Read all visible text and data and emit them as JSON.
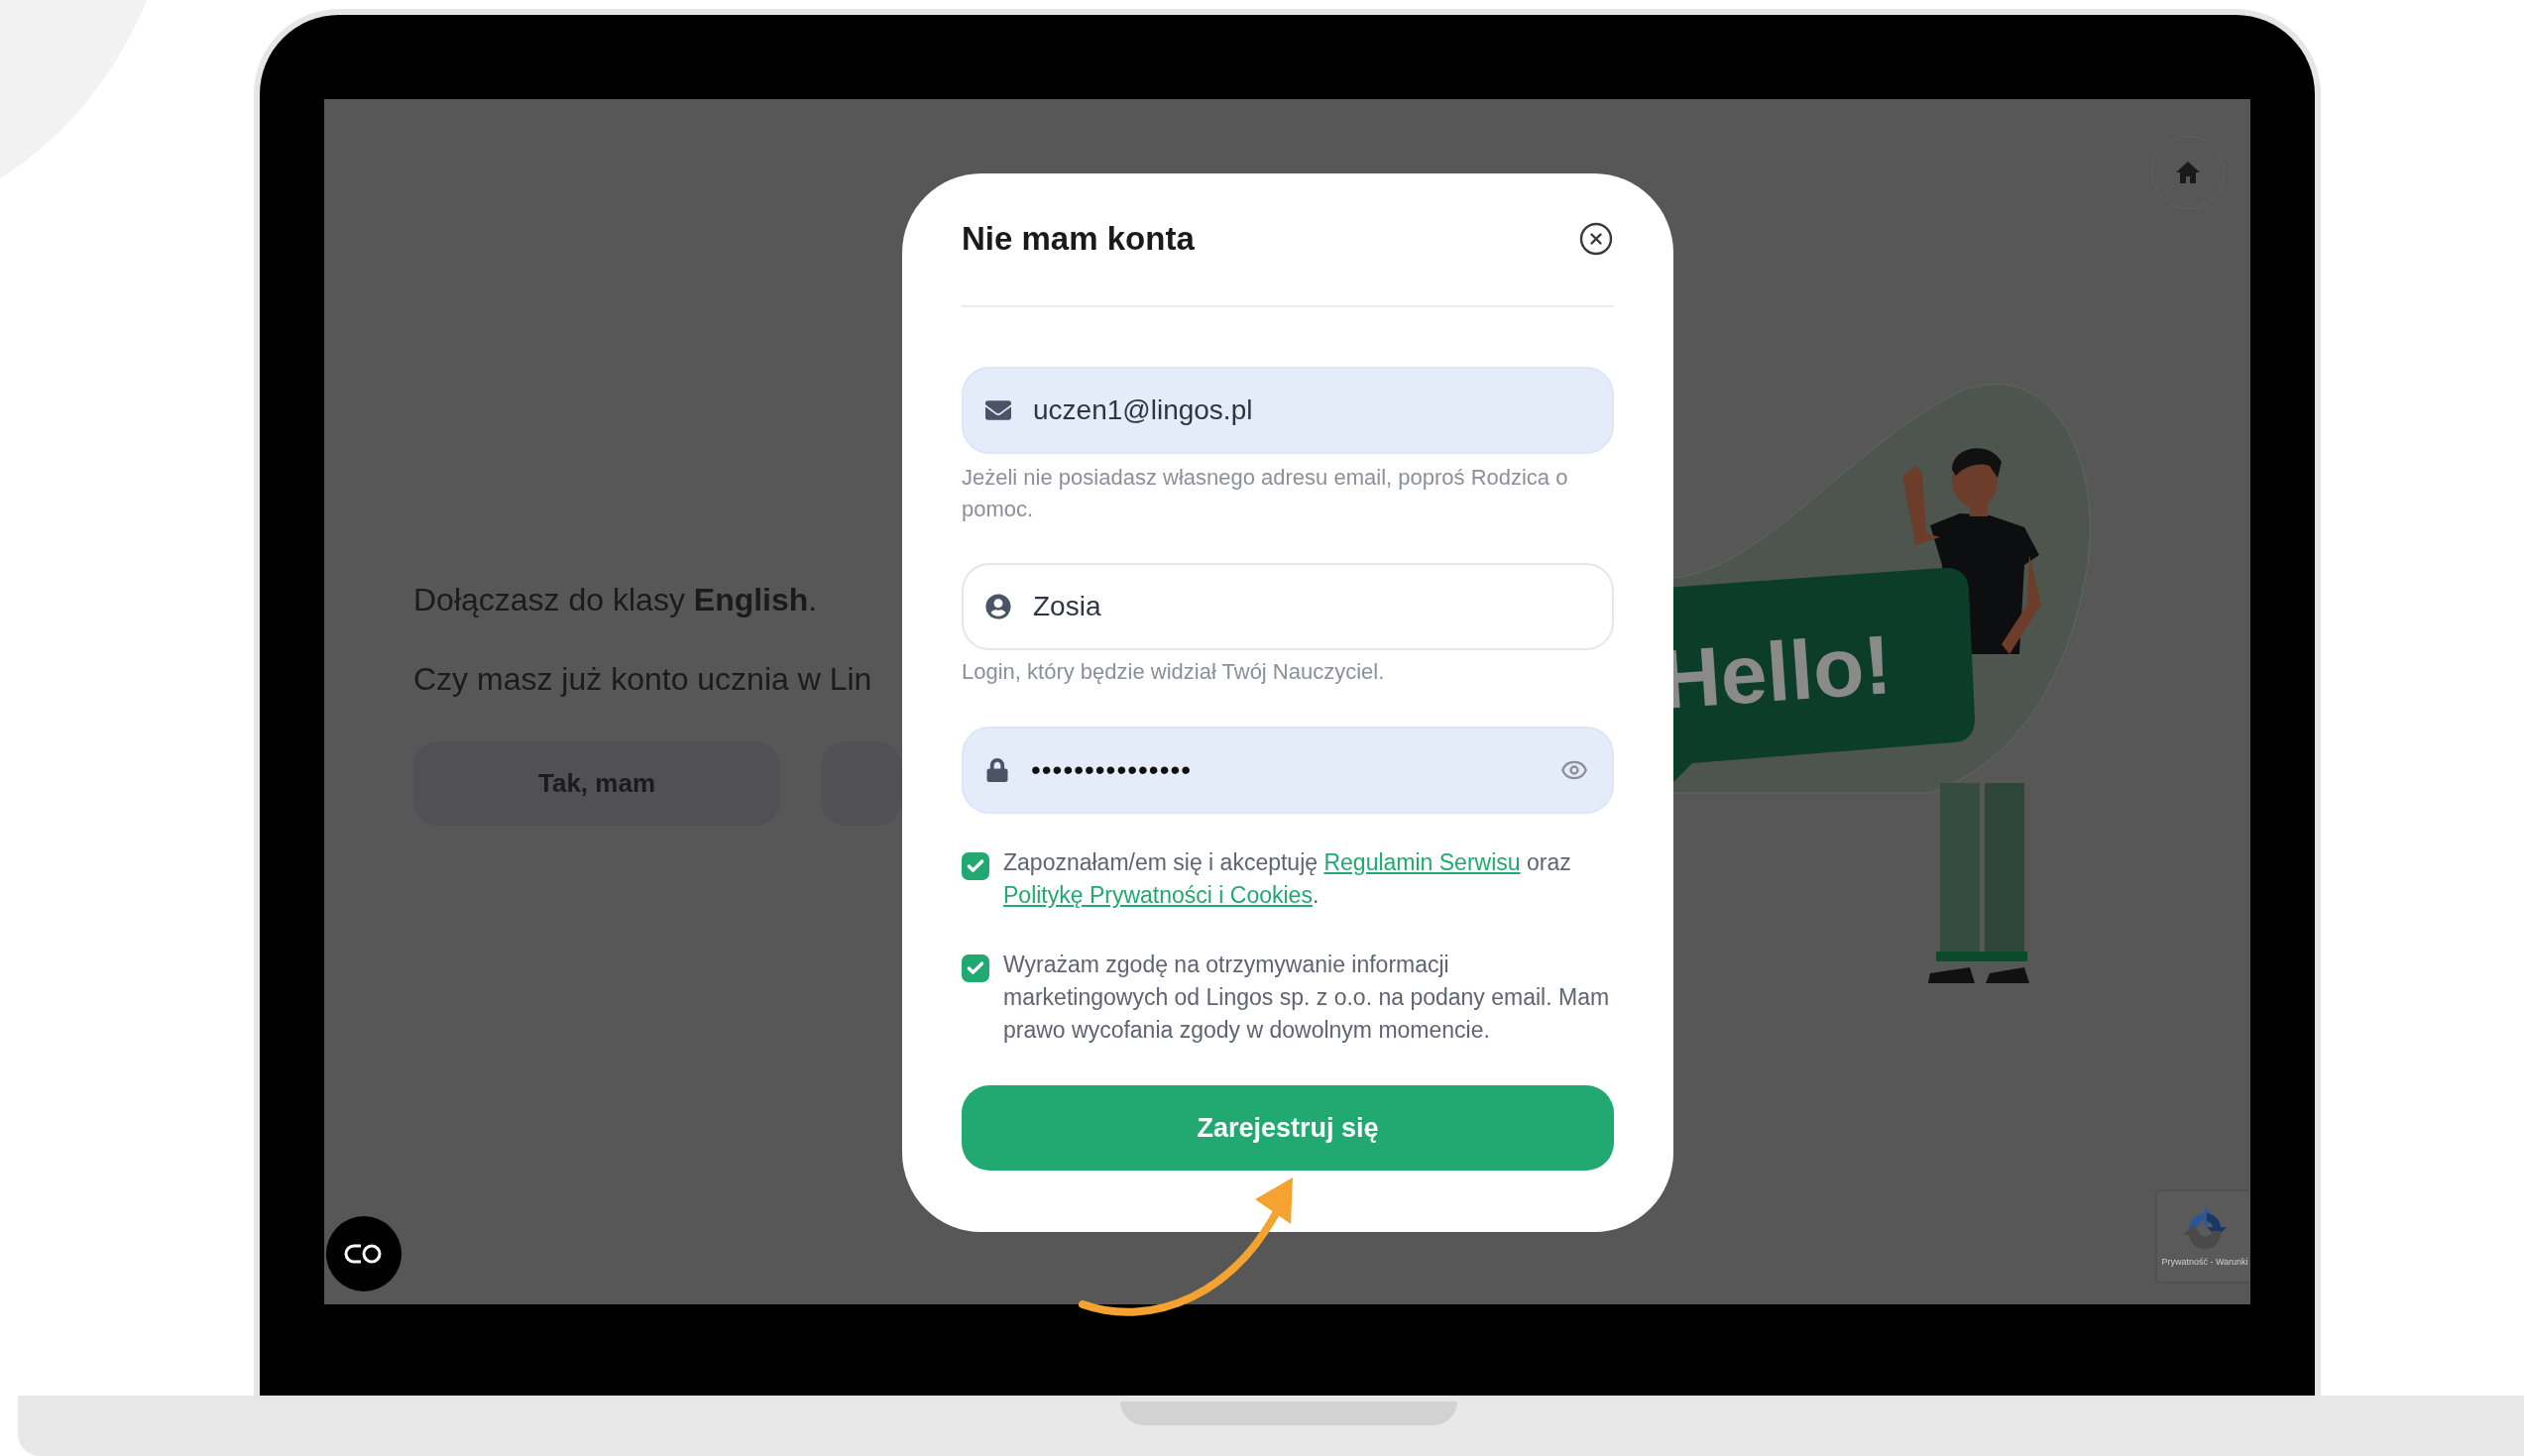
{
  "page": {
    "intro": "Dołączasz do klasy **English**.",
    "question": "Czy masz już konto ucznia w Lin",
    "buttons": [
      {
        "kind": "labelled",
        "label": "Tak, mam"
      },
      {
        "kind": "covered"
      }
    ]
  },
  "illustration": {
    "sign_text": "Hello!"
  },
  "recaptcha": {
    "caption": "Prywatność - Warunki"
  },
  "modal": {
    "title": "Nie mam konta",
    "fields": [
      {
        "kind": "email",
        "value": "uczen1@lingos.pl",
        "filled": true,
        "hint": "Jeżeli nie posiadasz własnego adresu email, poproś Rodzica o pomoc."
      },
      {
        "kind": "user",
        "value": "Zosia",
        "filled": false,
        "hint": "Login, który będzie widział Twój Nauczyciel."
      },
      {
        "kind": "password",
        "value": "•••••••••••••••",
        "filled": true
      }
    ],
    "consents": [
      {
        "checked": true,
        "segments": [
          {
            "kind": "text",
            "text": "Zapoznałam/em się i akceptuję "
          },
          {
            "kind": "link",
            "text": "Regulamin Serwisu"
          },
          {
            "kind": "text",
            "text": " oraz "
          },
          {
            "kind": "link",
            "text": "Politykę Prywatności i Cookies"
          },
          {
            "kind": "text",
            "text": "."
          }
        ]
      },
      {
        "checked": true,
        "segments": [
          {
            "kind": "text",
            "text": "Wyrażam zgodę na otrzymywanie informacji marketingowych od Lingos sp. z o.o. na podany email. Mam prawo wycofania zgody w dowolnym momencie."
          }
        ]
      }
    ],
    "submit": "Zarejestruj się"
  }
}
